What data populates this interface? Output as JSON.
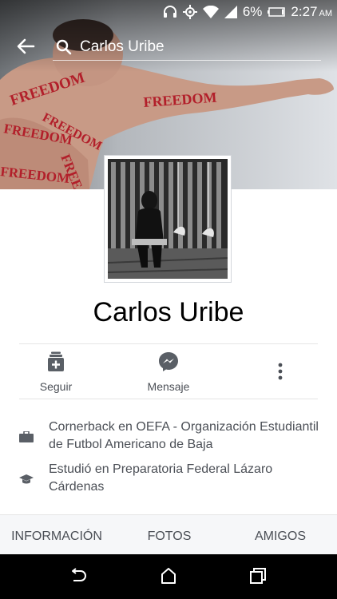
{
  "status_bar": {
    "battery_percent": "6%",
    "time": "2:27",
    "time_suffix": "AM"
  },
  "search": {
    "query": "Carlos Uribe"
  },
  "cover": {
    "text_marks": [
      "FREEDOM",
      "FREEDOM",
      "FREEDOM",
      "FREEDOM",
      "FREEDOM",
      "FREE"
    ]
  },
  "profile": {
    "name": "Carlos Uribe"
  },
  "actions": {
    "follow_label": "Seguir",
    "message_label": "Mensaje"
  },
  "info": {
    "work": "Cornerback en OEFA - Organización Estudiantil de Futbol Americano de Baja",
    "education": "Estudió en Preparatoria Federal Lázaro Cárdenas"
  },
  "tabs": {
    "info": "INFORMACIÓN",
    "photos": "FOTOS",
    "friends": "AMIGOS"
  },
  "colors": {
    "text_primary": "#000000",
    "text_secondary": "#4b4f56",
    "icon_gray": "#5a5f66",
    "tab_bar_bg": "#f6f7f9",
    "nav_bar_bg": "#000000",
    "freedom_text": "#b21f2a"
  },
  "icons": {
    "headphones": "headphones-icon",
    "location": "location-icon",
    "wifi": "wifi-icon",
    "signal": "signal-icon",
    "battery": "battery-icon",
    "back": "back-arrow-icon",
    "search": "search-icon",
    "follow": "follow-icon",
    "message": "messenger-icon",
    "more": "more-vertical-icon",
    "work": "briefcase-icon",
    "education": "graduation-cap-icon",
    "nav_back": "nav-back-icon",
    "nav_home": "nav-home-icon",
    "nav_recents": "nav-recents-icon"
  }
}
